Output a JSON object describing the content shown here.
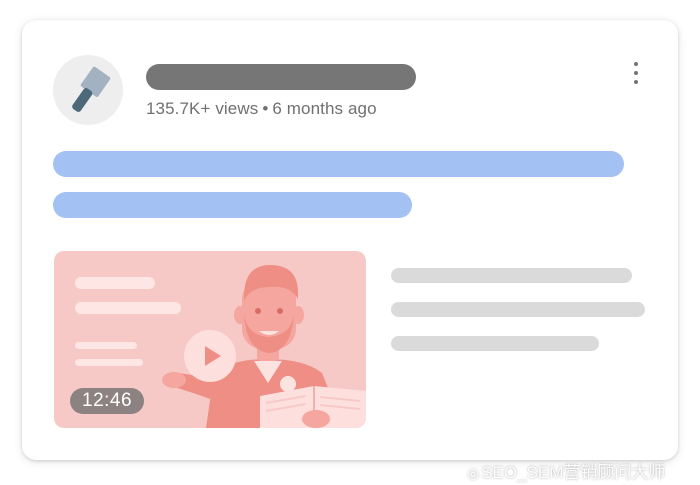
{
  "post": {
    "views": "135.7K+ views",
    "separator": "•",
    "age": "6 months ago"
  },
  "video": {
    "duration": "12:46"
  },
  "icons": {
    "avatar": "hammer-icon",
    "menu": "more-vert-icon",
    "play": "play-icon"
  },
  "colors": {
    "placeholder_dark": "#767676",
    "placeholder_blue": "#a4c1f4",
    "placeholder_grey": "#dadada",
    "thumbnail_bg": "#f6c9c7",
    "illustration": "#ee8e85"
  },
  "watermark": {
    "text": "SEO_SEM营销顾问大师"
  }
}
